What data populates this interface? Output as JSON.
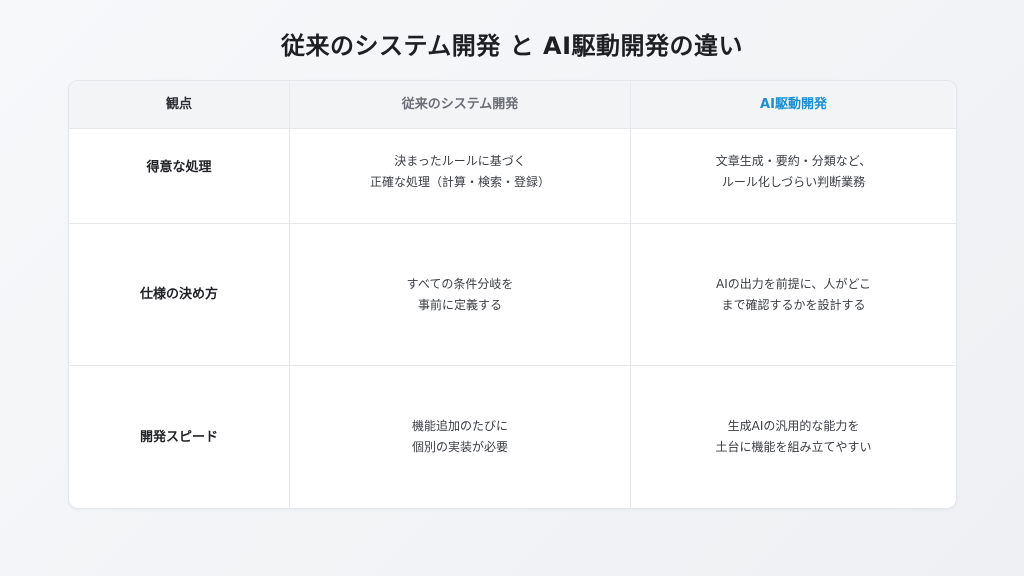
{
  "title": "従来のシステム開発 と AI駆動開発の違い",
  "table": {
    "headers": [
      "観点",
      "従来のシステム開発",
      "AI駆動開発"
    ],
    "rows": [
      {
        "label": "得意な処理",
        "traditional": "決まったルールに基づく\n正確な処理（計算・検索・登録）",
        "ai": "文章生成・要約・分類など、\nルール化しづらい判断業務"
      },
      {
        "label": "仕様の決め方",
        "traditional": "すべての条件分岐を\n事前に定義する",
        "ai": "AIの出力を前提に、人がどこ\nまで確認するかを設計する"
      },
      {
        "label": "開発スピード",
        "traditional": "機能追加のたびに\n個別の実装が必要",
        "ai": "生成AIの汎用的な能力を\n土台に機能を組み立てやすい"
      }
    ]
  },
  "colors": {
    "accent": "#1a8fd1",
    "header_bg": "#f3f4f6",
    "border": "#e6e8eb"
  }
}
